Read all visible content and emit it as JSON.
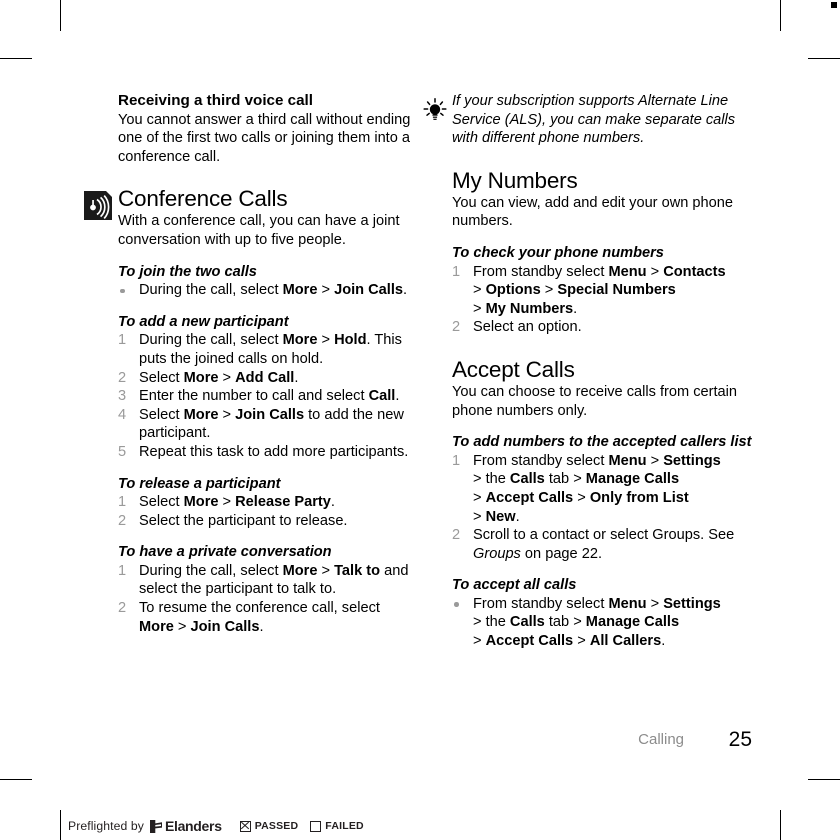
{
  "document": {
    "footer": {
      "chapter": "Calling",
      "page_number": "25"
    }
  },
  "left_column": {
    "section_receiving": {
      "heading": "Receiving a third voice call",
      "body": "You cannot answer a third call without ending one of the first two calls or joining them into a conference call."
    },
    "chapter": {
      "icon": "broadcast-icon",
      "title": "Conference Calls",
      "intro": "With a conference call, you can have a joint conversation with up to five people."
    },
    "task_join": {
      "title": "To join the two calls",
      "steps": [
        {
          "marker": "bullet",
          "parts": [
            {
              "text": "During the call, select ",
              "style": "normal"
            },
            {
              "text": "More",
              "style": "bold"
            },
            {
              "text": " > ",
              "style": "normal"
            },
            {
              "text": "Join Calls",
              "style": "bold"
            },
            {
              "text": ".",
              "style": "normal"
            }
          ]
        }
      ]
    },
    "task_add": {
      "title": "To add a new participant",
      "steps": [
        {
          "marker": "1",
          "parts": [
            {
              "text": "During the call, select ",
              "style": "normal"
            },
            {
              "text": "More",
              "style": "bold"
            },
            {
              "text": " > ",
              "style": "normal"
            },
            {
              "text": "Hold",
              "style": "bold"
            },
            {
              "text": ". This puts the joined calls on hold.",
              "style": "normal"
            }
          ]
        },
        {
          "marker": "2",
          "parts": [
            {
              "text": "Select ",
              "style": "normal"
            },
            {
              "text": "More",
              "style": "bold"
            },
            {
              "text": " > ",
              "style": "normal"
            },
            {
              "text": "Add Call",
              "style": "bold"
            },
            {
              "text": ".",
              "style": "normal"
            }
          ]
        },
        {
          "marker": "3",
          "parts": [
            {
              "text": "Enter the number to call and select ",
              "style": "normal"
            },
            {
              "text": "Call",
              "style": "bold"
            },
            {
              "text": ".",
              "style": "normal"
            }
          ]
        },
        {
          "marker": "4",
          "parts": [
            {
              "text": "Select ",
              "style": "normal"
            },
            {
              "text": "More",
              "style": "bold"
            },
            {
              "text": " > ",
              "style": "normal"
            },
            {
              "text": "Join Calls",
              "style": "bold"
            },
            {
              "text": " to add the new participant.",
              "style": "normal"
            }
          ]
        },
        {
          "marker": "5",
          "parts": [
            {
              "text": "Repeat this task to add more participants.",
              "style": "normal"
            }
          ]
        }
      ]
    },
    "task_release": {
      "title": "To release a participant",
      "steps": [
        {
          "marker": "1",
          "parts": [
            {
              "text": "Select ",
              "style": "normal"
            },
            {
              "text": "More",
              "style": "bold"
            },
            {
              "text": " > ",
              "style": "normal"
            },
            {
              "text": "Release Party",
              "style": "bold"
            },
            {
              "text": ".",
              "style": "normal"
            }
          ]
        },
        {
          "marker": "2",
          "parts": [
            {
              "text": "Select the participant to release.",
              "style": "normal"
            }
          ]
        }
      ]
    },
    "task_private": {
      "title": "To have a private conversation",
      "steps": [
        {
          "marker": "1",
          "parts": [
            {
              "text": "During the call, select ",
              "style": "normal"
            },
            {
              "text": "More",
              "style": "bold"
            },
            {
              "text": " > ",
              "style": "normal"
            },
            {
              "text": "Talk to",
              "style": "bold"
            },
            {
              "text": " and select the participant to talk to.",
              "style": "normal"
            }
          ]
        },
        {
          "marker": "2",
          "parts": [
            {
              "text": "To resume the conference call, select ",
              "style": "normal"
            },
            {
              "text": "More",
              "style": "bold"
            },
            {
              "text": " > ",
              "style": "normal"
            },
            {
              "text": "Join Calls",
              "style": "bold"
            },
            {
              "text": ".",
              "style": "normal"
            }
          ]
        }
      ]
    }
  },
  "right_column": {
    "tip": {
      "icon": "lightbulb-icon",
      "text": "If your subscription supports Alternate Line Service (ALS), you can make separate calls with different phone numbers."
    },
    "section_my_numbers": {
      "title": "My Numbers",
      "intro": "You can view, add and edit your own phone numbers.",
      "task": {
        "title": "To check your phone numbers",
        "steps": [
          {
            "marker": "1",
            "parts": [
              {
                "text": "From standby select ",
                "style": "normal"
              },
              {
                "text": "Menu",
                "style": "bold"
              },
              {
                "text": " > ",
                "style": "normal"
              },
              {
                "text": "Contacts",
                "style": "bold"
              },
              {
                "text": "\n> ",
                "style": "normal"
              },
              {
                "text": "Options",
                "style": "bold"
              },
              {
                "text": " > ",
                "style": "normal"
              },
              {
                "text": "Special Numbers",
                "style": "bold"
              },
              {
                "text": "\n> ",
                "style": "normal"
              },
              {
                "text": "My Numbers",
                "style": "bold"
              },
              {
                "text": ".",
                "style": "normal"
              }
            ]
          },
          {
            "marker": "2",
            "parts": [
              {
                "text": "Select an option.",
                "style": "normal"
              }
            ]
          }
        ]
      }
    },
    "section_accept_calls": {
      "title": "Accept Calls",
      "intro": "You can choose to receive calls from certain phone numbers only.",
      "task_add": {
        "title": "To add numbers to the accepted callers list",
        "steps": [
          {
            "marker": "1",
            "parts": [
              {
                "text": "From standby select ",
                "style": "normal"
              },
              {
                "text": "Menu",
                "style": "bold"
              },
              {
                "text": " > ",
                "style": "normal"
              },
              {
                "text": "Settings",
                "style": "bold"
              },
              {
                "text": "\n> the ",
                "style": "normal"
              },
              {
                "text": "Calls",
                "style": "bold"
              },
              {
                "text": " tab > ",
                "style": "normal"
              },
              {
                "text": "Manage Calls",
                "style": "bold"
              },
              {
                "text": "\n> ",
                "style": "normal"
              },
              {
                "text": "Accept Calls",
                "style": "bold"
              },
              {
                "text": " > ",
                "style": "normal"
              },
              {
                "text": "Only from List",
                "style": "bold"
              },
              {
                "text": "\n> ",
                "style": "normal"
              },
              {
                "text": "New",
                "style": "bold"
              },
              {
                "text": ".",
                "style": "normal"
              }
            ]
          },
          {
            "marker": "2",
            "parts": [
              {
                "text": "Scroll to a contact or select Groups. See ",
                "style": "normal"
              },
              {
                "text": "Groups",
                "style": "italic"
              },
              {
                "text": " on page 22.",
                "style": "normal"
              }
            ]
          }
        ]
      },
      "task_all": {
        "title": "To accept all calls",
        "steps": [
          {
            "marker": "bullet",
            "parts": [
              {
                "text": "From standby select ",
                "style": "normal"
              },
              {
                "text": "Menu",
                "style": "bold"
              },
              {
                "text": " > ",
                "style": "normal"
              },
              {
                "text": "Settings",
                "style": "bold"
              },
              {
                "text": "\n> the ",
                "style": "normal"
              },
              {
                "text": "Calls",
                "style": "bold"
              },
              {
                "text": " tab > ",
                "style": "normal"
              },
              {
                "text": "Manage Calls",
                "style": "bold"
              },
              {
                "text": "\n> ",
                "style": "normal"
              },
              {
                "text": "Accept Calls",
                "style": "bold"
              },
              {
                "text": " > ",
                "style": "normal"
              },
              {
                "text": "All Callers",
                "style": "bold"
              },
              {
                "text": ".",
                "style": "normal"
              }
            ]
          }
        ]
      }
    }
  },
  "preflight_bar": {
    "label": "Preflighted by",
    "logo_text": "Elanders",
    "passed_label": "PASSED",
    "failed_label": "FAILED",
    "passed_checked": true,
    "failed_checked": false
  }
}
